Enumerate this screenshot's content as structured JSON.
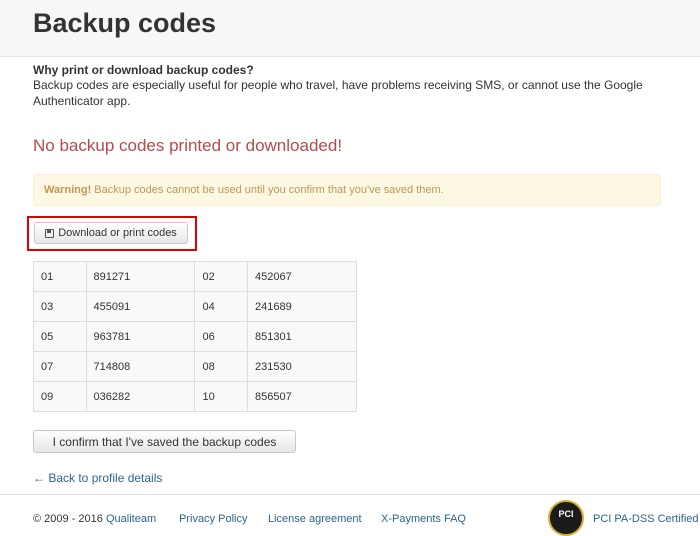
{
  "page": {
    "title": "Backup codes",
    "why_heading": "Why print or download backup codes?",
    "why_text": "Backup codes are especially useful for people who travel, have problems receiving SMS, or cannot use the Google Authenticator app.",
    "status_heading": "No backup codes printed or downloaded!",
    "warning_label": "Warning!",
    "warning_text": " Backup codes cannot be used until you confirm that you've saved them.",
    "download_button": "Download or print codes",
    "confirm_button": "I confirm that I've saved the backup codes",
    "back_link": "← Back to profile details"
  },
  "codes": [
    {
      "num1": "01",
      "code1": "891271",
      "num2": "02",
      "code2": "452067"
    },
    {
      "num1": "03",
      "code1": "455091",
      "num2": "04",
      "code2": "241689"
    },
    {
      "num1": "05",
      "code1": "963781",
      "num2": "06",
      "code2": "851301"
    },
    {
      "num1": "07",
      "code1": "714808",
      "num2": "08",
      "code2": "231530"
    },
    {
      "num1": "09",
      "code1": "036282",
      "num2": "10",
      "code2": "856507"
    }
  ],
  "footer": {
    "copyright": "© 2009 - 2016",
    "qualiteam": "Qualiteam",
    "privacy": "Privacy Policy",
    "license": "License agreement",
    "faq": "X-Payments FAQ",
    "pci_badge": "PCI",
    "pci": "PCI PA-DSS Certified"
  },
  "colors": {
    "error": "#b94a48",
    "warning_bg": "#fcf8e3",
    "warning_text": "#c09853",
    "link": "#2a6496",
    "highlight": "#e00000"
  },
  "icons": {
    "download_button_icon": "floppy-disk-icon",
    "footer_badge": "pci-badge-logo"
  }
}
